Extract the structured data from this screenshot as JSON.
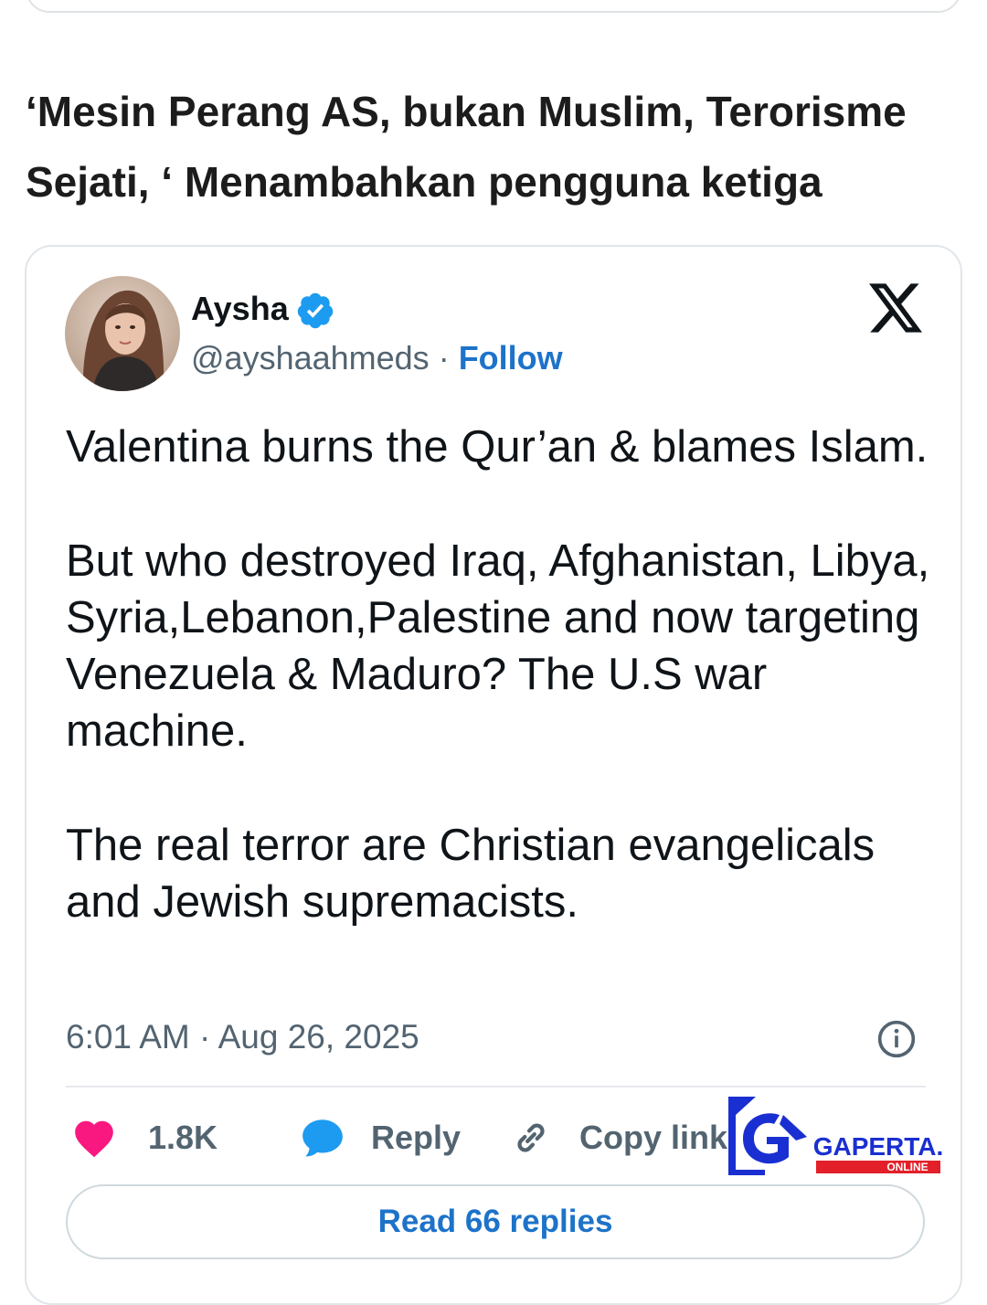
{
  "headline": "‘Mesin Perang AS, bukan Muslim, Terorisme Sejati, ‘ Menambahkan pengguna ketiga",
  "tweet": {
    "author_name": "Aysha",
    "handle": "@ayshaahmeds",
    "separator": " · ",
    "follow_label": "Follow",
    "paragraphs": [
      "Valentina burns the Qur’an & blames Islam.",
      "But who destroyed Iraq, Afghanistan, Libya, Syria,Lebanon,Palestine and now targeting Venezuela & Maduro? The U.S war machine.",
      "The real terror are Christian evangelicals and Jewish supremacists."
    ],
    "timestamp": "6:01 AM · Aug 26, 2025",
    "likes": "1.8K",
    "reply_label": "Reply",
    "copy_link_label": "Copy link",
    "read_replies_label": "Read 66 replies"
  },
  "watermark": {
    "brand": "GAPERTA.",
    "sub": "ONLINE"
  },
  "colors": {
    "link": "#1d73c9",
    "heart": "#f91880",
    "reply_bubble": "#1d9bf0",
    "verified": "#1d9bf0",
    "secondary_text": "#536471",
    "brand_blue": "#1a2fd1",
    "brand_red": "#e3202a"
  },
  "icons": [
    "verified-badge-icon",
    "x-logo-icon",
    "info-icon",
    "heart-icon",
    "reply-bubble-icon",
    "link-icon"
  ]
}
